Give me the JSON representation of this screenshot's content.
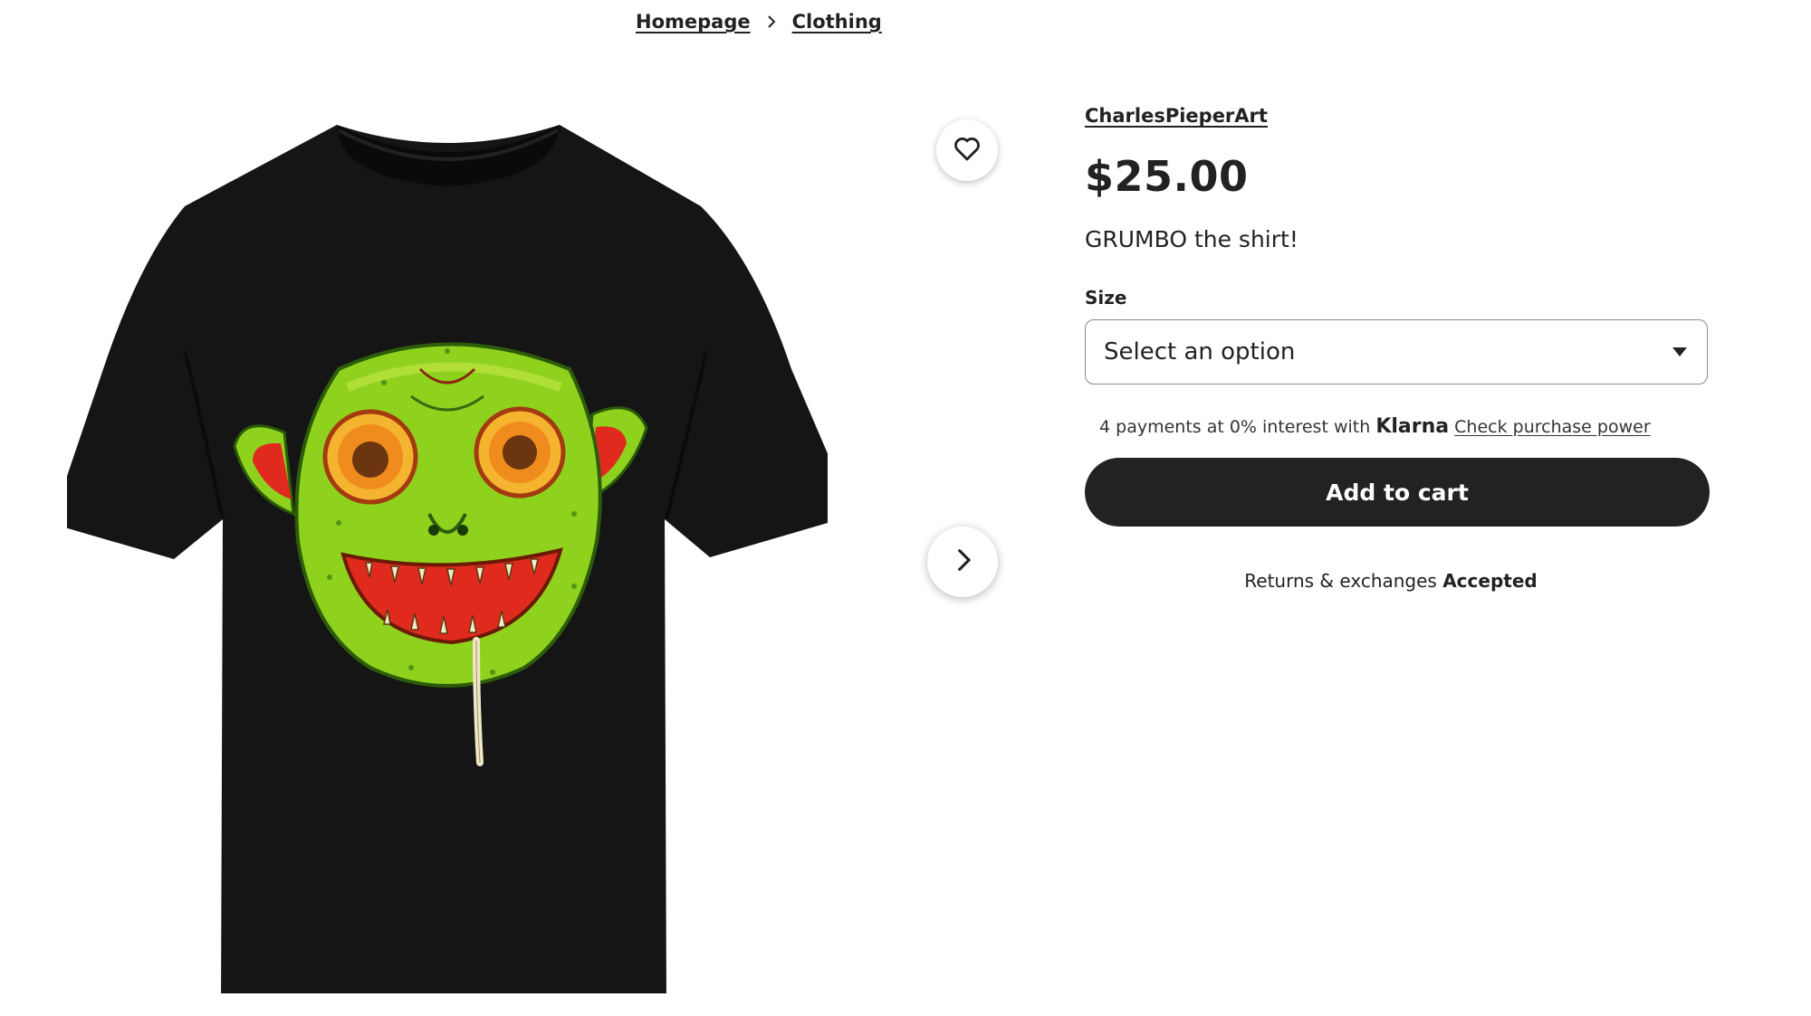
{
  "breadcrumb": {
    "items": [
      "Homepage",
      "Clothing"
    ]
  },
  "listing": {
    "shop_name": "CharlesPieperArt",
    "price": "$25.00",
    "title": "GRUMBO the shirt!",
    "size": {
      "label": "Size",
      "selected": "Select an option"
    },
    "klarna": {
      "text": "4 payments at 0% interest with",
      "brand": "Klarna",
      "link": "Check purchase power"
    },
    "add_to_cart": "Add to cart",
    "returns": {
      "text": "Returns & exchanges",
      "status": "Accepted"
    }
  },
  "icons": {
    "favorite": "heart-icon",
    "next": "chevron-right-icon",
    "separator": "chevron-right-icon",
    "select": "caret-down-icon"
  },
  "colors": {
    "text": "#222222",
    "button_bg": "#222222",
    "button_text": "#ffffff",
    "shirt": "#151515",
    "face": "#8fd21e",
    "mouth": "#e02a1e"
  }
}
